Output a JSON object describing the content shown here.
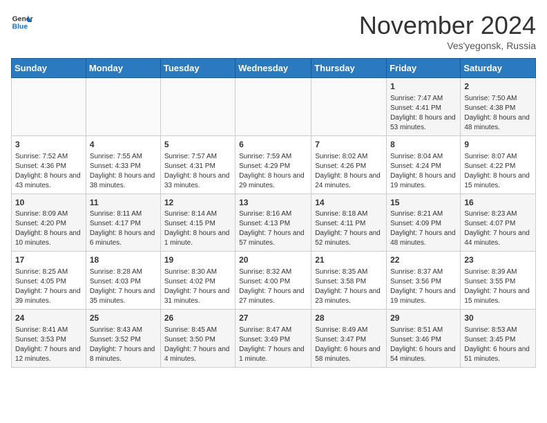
{
  "header": {
    "logo_line1": "General",
    "logo_line2": "Blue",
    "month": "November 2024",
    "location": "Ves'yegonsk, Russia"
  },
  "weekdays": [
    "Sunday",
    "Monday",
    "Tuesday",
    "Wednesday",
    "Thursday",
    "Friday",
    "Saturday"
  ],
  "weeks": [
    [
      {
        "day": "",
        "info": ""
      },
      {
        "day": "",
        "info": ""
      },
      {
        "day": "",
        "info": ""
      },
      {
        "day": "",
        "info": ""
      },
      {
        "day": "",
        "info": ""
      },
      {
        "day": "1",
        "info": "Sunrise: 7:47 AM\nSunset: 4:41 PM\nDaylight: 8 hours and 53 minutes."
      },
      {
        "day": "2",
        "info": "Sunrise: 7:50 AM\nSunset: 4:38 PM\nDaylight: 8 hours and 48 minutes."
      }
    ],
    [
      {
        "day": "3",
        "info": "Sunrise: 7:52 AM\nSunset: 4:36 PM\nDaylight: 8 hours and 43 minutes."
      },
      {
        "day": "4",
        "info": "Sunrise: 7:55 AM\nSunset: 4:33 PM\nDaylight: 8 hours and 38 minutes."
      },
      {
        "day": "5",
        "info": "Sunrise: 7:57 AM\nSunset: 4:31 PM\nDaylight: 8 hours and 33 minutes."
      },
      {
        "day": "6",
        "info": "Sunrise: 7:59 AM\nSunset: 4:29 PM\nDaylight: 8 hours and 29 minutes."
      },
      {
        "day": "7",
        "info": "Sunrise: 8:02 AM\nSunset: 4:26 PM\nDaylight: 8 hours and 24 minutes."
      },
      {
        "day": "8",
        "info": "Sunrise: 8:04 AM\nSunset: 4:24 PM\nDaylight: 8 hours and 19 minutes."
      },
      {
        "day": "9",
        "info": "Sunrise: 8:07 AM\nSunset: 4:22 PM\nDaylight: 8 hours and 15 minutes."
      }
    ],
    [
      {
        "day": "10",
        "info": "Sunrise: 8:09 AM\nSunset: 4:20 PM\nDaylight: 8 hours and 10 minutes."
      },
      {
        "day": "11",
        "info": "Sunrise: 8:11 AM\nSunset: 4:17 PM\nDaylight: 8 hours and 6 minutes."
      },
      {
        "day": "12",
        "info": "Sunrise: 8:14 AM\nSunset: 4:15 PM\nDaylight: 8 hours and 1 minute."
      },
      {
        "day": "13",
        "info": "Sunrise: 8:16 AM\nSunset: 4:13 PM\nDaylight: 7 hours and 57 minutes."
      },
      {
        "day": "14",
        "info": "Sunrise: 8:18 AM\nSunset: 4:11 PM\nDaylight: 7 hours and 52 minutes."
      },
      {
        "day": "15",
        "info": "Sunrise: 8:21 AM\nSunset: 4:09 PM\nDaylight: 7 hours and 48 minutes."
      },
      {
        "day": "16",
        "info": "Sunrise: 8:23 AM\nSunset: 4:07 PM\nDaylight: 7 hours and 44 minutes."
      }
    ],
    [
      {
        "day": "17",
        "info": "Sunrise: 8:25 AM\nSunset: 4:05 PM\nDaylight: 7 hours and 39 minutes."
      },
      {
        "day": "18",
        "info": "Sunrise: 8:28 AM\nSunset: 4:03 PM\nDaylight: 7 hours and 35 minutes."
      },
      {
        "day": "19",
        "info": "Sunrise: 8:30 AM\nSunset: 4:02 PM\nDaylight: 7 hours and 31 minutes."
      },
      {
        "day": "20",
        "info": "Sunrise: 8:32 AM\nSunset: 4:00 PM\nDaylight: 7 hours and 27 minutes."
      },
      {
        "day": "21",
        "info": "Sunrise: 8:35 AM\nSunset: 3:58 PM\nDaylight: 7 hours and 23 minutes."
      },
      {
        "day": "22",
        "info": "Sunrise: 8:37 AM\nSunset: 3:56 PM\nDaylight: 7 hours and 19 minutes."
      },
      {
        "day": "23",
        "info": "Sunrise: 8:39 AM\nSunset: 3:55 PM\nDaylight: 7 hours and 15 minutes."
      }
    ],
    [
      {
        "day": "24",
        "info": "Sunrise: 8:41 AM\nSunset: 3:53 PM\nDaylight: 7 hours and 12 minutes."
      },
      {
        "day": "25",
        "info": "Sunrise: 8:43 AM\nSunset: 3:52 PM\nDaylight: 7 hours and 8 minutes."
      },
      {
        "day": "26",
        "info": "Sunrise: 8:45 AM\nSunset: 3:50 PM\nDaylight: 7 hours and 4 minutes."
      },
      {
        "day": "27",
        "info": "Sunrise: 8:47 AM\nSunset: 3:49 PM\nDaylight: 7 hours and 1 minute."
      },
      {
        "day": "28",
        "info": "Sunrise: 8:49 AM\nSunset: 3:47 PM\nDaylight: 6 hours and 58 minutes."
      },
      {
        "day": "29",
        "info": "Sunrise: 8:51 AM\nSunset: 3:46 PM\nDaylight: 6 hours and 54 minutes."
      },
      {
        "day": "30",
        "info": "Sunrise: 8:53 AM\nSunset: 3:45 PM\nDaylight: 6 hours and 51 minutes."
      }
    ]
  ]
}
